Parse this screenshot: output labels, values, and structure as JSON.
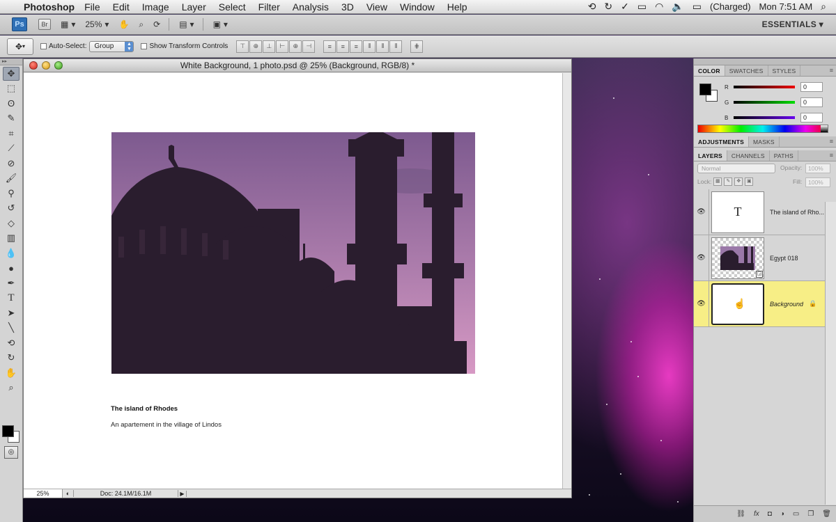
{
  "menubar": {
    "app_name": "Photoshop",
    "items": [
      "File",
      "Edit",
      "Image",
      "Layer",
      "Select",
      "Filter",
      "Analysis",
      "3D",
      "View",
      "Window",
      "Help"
    ],
    "battery": "(Charged)",
    "clock": "Mon 7:51 AM"
  },
  "appbar": {
    "ps_label": "Ps",
    "br_label": "Br",
    "zoom": "25%",
    "workspace": "ESSENTIALS"
  },
  "options": {
    "auto_select_label": "Auto-Select:",
    "auto_select_value": "Group",
    "transform_label": "Show Transform Controls"
  },
  "document": {
    "title": "White Background, 1 photo.psd @ 25% (Background, RGB/8) *",
    "caption_title": "The island of Rhodes",
    "caption_subtitle": "An apartement in the village of Lindos",
    "status_zoom": "25%",
    "status_doc": "Doc: 24.1M/16.1M"
  },
  "color_panel": {
    "tabs": [
      "COLOR",
      "SWATCHES",
      "STYLES"
    ],
    "r_label": "R",
    "g_label": "G",
    "b_label": "B",
    "r_value": "0",
    "g_value": "0",
    "b_value": "0"
  },
  "adjust_panel": {
    "tabs": [
      "ADJUSTMENTS",
      "MASKS"
    ]
  },
  "layers_panel": {
    "tabs": [
      "LAYERS",
      "CHANNELS",
      "PATHS"
    ],
    "blend_mode": "Normal",
    "opacity_label": "Opacity:",
    "opacity_value": "100%",
    "lock_label": "Lock:",
    "fill_label": "Fill:",
    "fill_value": "100%",
    "text_thumb_glyph": "T",
    "layers": [
      {
        "name": "The island of Rho..."
      },
      {
        "name": "Egypt 018"
      },
      {
        "name": "Background"
      }
    ]
  },
  "colors": {
    "selected_layer": "#f7ee86",
    "sky_top": "#7d5a8f",
    "sky_bottom": "#d799c4",
    "silhouette": "#2a1d2e"
  }
}
